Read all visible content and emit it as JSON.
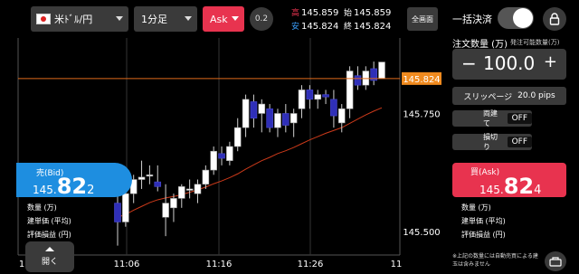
{
  "toolbar": {
    "pair": "米ﾄﾞﾙ/円",
    "timeframe": "1分足",
    "side": "Ask",
    "spread": "0.2",
    "quotes": {
      "high_label": "高",
      "high": "145.859",
      "open_label": "始",
      "open": "145.859",
      "low_label": "安",
      "low": "145.824",
      "close_label": "終",
      "close": "145.824"
    },
    "fullscreen_label": "全画面"
  },
  "chart": {
    "current_price": "145.824",
    "y_ticks": [
      "145.750",
      "145.500"
    ],
    "x_ticks": [
      "1",
      "11:06",
      "11:16",
      "11:26",
      "11"
    ],
    "colors": {
      "up": "#ffffff",
      "down": "#2f2fb8",
      "ma": "#cc3a1a",
      "price_line": "#e06a1a",
      "price_tag": "#f08a1e"
    }
  },
  "chart_data": {
    "type": "candlestick",
    "candles": [
      {
        "o": 145.56,
        "h": 145.6,
        "l": 145.47,
        "c": 145.52
      },
      {
        "o": 145.52,
        "h": 145.6,
        "l": 145.51,
        "c": 145.58
      },
      {
        "o": 145.58,
        "h": 145.62,
        "l": 145.56,
        "c": 145.61
      },
      {
        "o": 145.61,
        "h": 145.65,
        "l": 145.59,
        "c": 145.615
      },
      {
        "o": 145.62,
        "h": 145.64,
        "l": 145.6,
        "c": 145.62
      },
      {
        "o": 145.605,
        "h": 145.64,
        "l": 145.585,
        "c": 145.595
      },
      {
        "o": 145.53,
        "h": 145.6,
        "l": 145.49,
        "c": 145.56
      },
      {
        "o": 145.55,
        "h": 145.58,
        "l": 145.52,
        "c": 145.57
      },
      {
        "o": 145.57,
        "h": 145.6,
        "l": 145.55,
        "c": 145.595
      },
      {
        "o": 145.59,
        "h": 145.61,
        "l": 145.57,
        "c": 145.59
      },
      {
        "o": 145.58,
        "h": 145.61,
        "l": 145.56,
        "c": 145.6
      },
      {
        "o": 145.6,
        "h": 145.64,
        "l": 145.59,
        "c": 145.63
      },
      {
        "o": 145.63,
        "h": 145.68,
        "l": 145.62,
        "c": 145.67
      },
      {
        "o": 145.665,
        "h": 145.68,
        "l": 145.64,
        "c": 145.655
      },
      {
        "o": 145.65,
        "h": 145.69,
        "l": 145.64,
        "c": 145.68
      },
      {
        "o": 145.68,
        "h": 145.74,
        "l": 145.67,
        "c": 145.72
      },
      {
        "o": 145.72,
        "h": 145.79,
        "l": 145.7,
        "c": 145.78
      },
      {
        "o": 145.775,
        "h": 145.79,
        "l": 145.72,
        "c": 145.74
      },
      {
        "o": 145.75,
        "h": 145.78,
        "l": 145.71,
        "c": 145.77
      },
      {
        "o": 145.76,
        "h": 145.77,
        "l": 145.71,
        "c": 145.72
      },
      {
        "o": 145.72,
        "h": 145.76,
        "l": 145.7,
        "c": 145.75
      },
      {
        "o": 145.75,
        "h": 145.77,
        "l": 145.71,
        "c": 145.725
      },
      {
        "o": 145.73,
        "h": 145.76,
        "l": 145.7,
        "c": 145.75
      },
      {
        "o": 145.76,
        "h": 145.81,
        "l": 145.74,
        "c": 145.8
      },
      {
        "o": 145.8,
        "h": 145.81,
        "l": 145.76,
        "c": 145.78
      },
      {
        "o": 145.78,
        "h": 145.8,
        "l": 145.76,
        "c": 145.79
      },
      {
        "o": 145.79,
        "h": 145.8,
        "l": 145.77,
        "c": 145.785
      },
      {
        "o": 145.78,
        "h": 145.8,
        "l": 145.72,
        "c": 145.745
      },
      {
        "o": 145.73,
        "h": 145.77,
        "l": 145.71,
        "c": 145.76
      },
      {
        "o": 145.76,
        "h": 145.85,
        "l": 145.74,
        "c": 145.84
      },
      {
        "o": 145.83,
        "h": 145.85,
        "l": 145.8,
        "c": 145.81
      },
      {
        "o": 145.81,
        "h": 145.85,
        "l": 145.8,
        "c": 145.84
      },
      {
        "o": 145.845,
        "h": 145.86,
        "l": 145.81,
        "c": 145.82
      },
      {
        "o": 145.824,
        "h": 145.859,
        "l": 145.824,
        "c": 145.859
      }
    ],
    "ma": [
      145.53,
      145.536,
      145.545,
      145.553,
      145.561,
      145.567,
      145.571,
      145.574,
      145.578,
      145.583,
      145.588,
      145.594,
      145.601,
      145.607,
      145.614,
      145.622,
      145.632,
      145.641,
      145.65,
      145.657,
      145.665,
      145.671,
      145.678,
      145.686,
      145.694,
      145.701,
      145.708,
      145.714,
      145.72,
      145.729,
      145.738,
      145.747,
      145.755,
      145.762
    ],
    "ylim": [
      145.45,
      145.91
    ]
  },
  "bid": {
    "label": "売(Bid)",
    "prefix": "145.",
    "big": "82",
    "last": "2"
  },
  "position": {
    "qty_label": "数量 (万)",
    "avg_label": "建単価 (平均)",
    "pl_label": "評価損益 (円)"
  },
  "open_button": "開く",
  "panel": {
    "bulk_label": "一括決済",
    "qty_label": "注文数量 (万)",
    "qty_avail": "発注可能数量(万)",
    "qty_minus": "−",
    "qty_value": "100.0",
    "qty_plus": "+",
    "slippage_label": "スリッページ",
    "slippage_value": "20.0 pips",
    "both_label": "両建て",
    "both_value": "OFF",
    "stop_label": "損切り",
    "stop_value": "OFF",
    "ask_label": "買(Ask)",
    "ask_prefix": "145.",
    "ask_big": "82",
    "ask_last": "4",
    "qty_label2": "数量 (万)",
    "avg_label2": "建単価 (平均)",
    "pl_label2": "評価損益 (円)",
    "note": "※上記の数量には自動売買による建玉は含みません"
  }
}
